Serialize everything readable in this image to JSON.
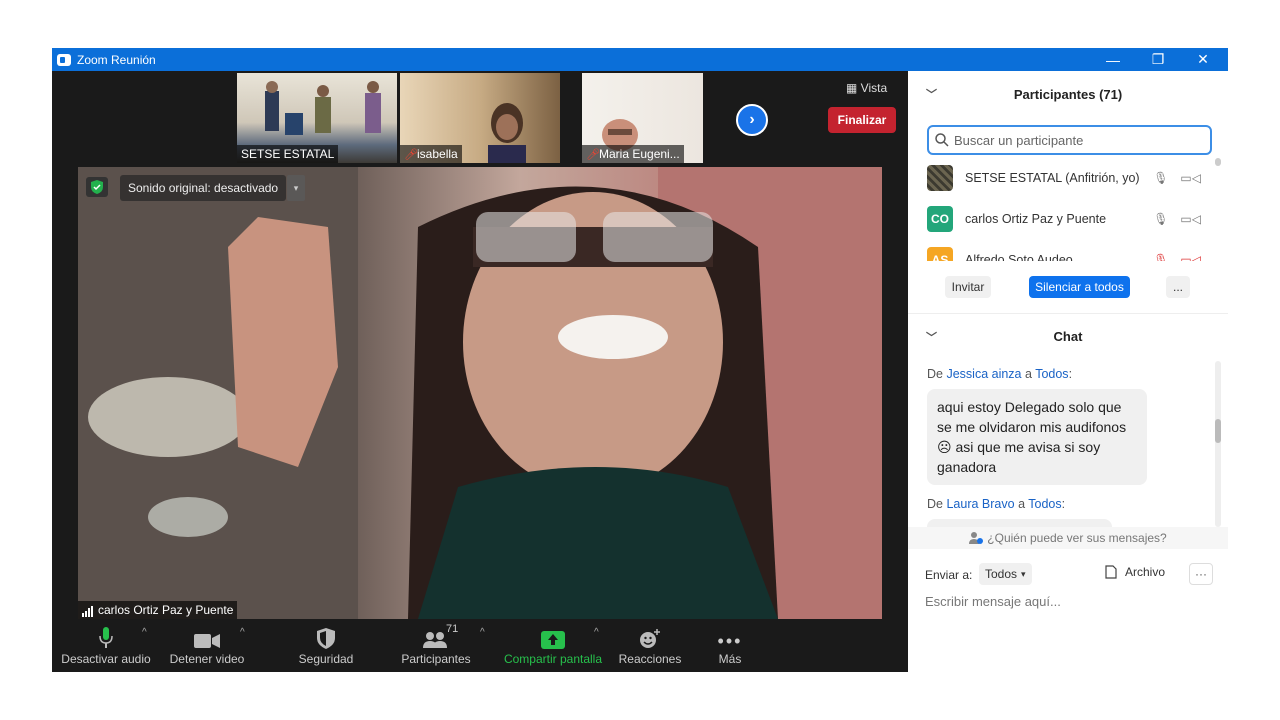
{
  "window": {
    "title": "Zoom Reunión",
    "controls": [
      "—",
      "❐",
      "✕"
    ]
  },
  "thumbnails": [
    {
      "name": "SETSE ESTATAL",
      "muted": false
    },
    {
      "name": "isabella",
      "muted": true
    },
    {
      "name": "Maria Eugeni...",
      "muted": true
    }
  ],
  "vista_label": "Vista",
  "main": {
    "sound_label": "Sonido original: desactivado",
    "speaker": "carlos Ortiz Paz y Puente"
  },
  "toolbar": {
    "audio": "Desactivar audio",
    "video": "Detener video",
    "security": "Seguridad",
    "participants": "Participantes",
    "participants_count": "71",
    "share": "Compartir pantalla",
    "reactions": "Reacciones",
    "more": "Más",
    "end": "Finalizar"
  },
  "participants_panel": {
    "title": "Participantes (71)",
    "search_placeholder": "Buscar un participante",
    "rows": [
      {
        "name": "SETSE ESTATAL (Anfitrión, yo)",
        "initials": "",
        "color": "#5a5a48"
      },
      {
        "name": "carlos Ortiz Paz y Puente",
        "initials": "CO",
        "color": "#23a67a"
      },
      {
        "name": "Alfredo Soto Audeo",
        "initials": "AS",
        "color": "#f5a623"
      }
    ],
    "invite": "Invitar",
    "mute_all": "Silenciar a todos",
    "more": "..."
  },
  "chat": {
    "title": "Chat",
    "messages": [
      {
        "prefix": "De",
        "from": "Jessica ainza",
        "mid": "a",
        "to": "Todos",
        "suffix": ":",
        "text": "aqui estoy Delegado solo que se me olvidaron mis audifonos ☹ asi que me avisa si soy ganadora"
      },
      {
        "prefix": "De",
        "from": "Laura Bravo",
        "mid": "a",
        "to": "Todos",
        "suffix": ":"
      }
    ],
    "who_sees": "¿Quién puede ver sus mensajes?",
    "send_to_label": "Enviar a:",
    "send_to_value": "Todos",
    "file_label": "Archivo",
    "more": "···",
    "input_placeholder": "Escribir mensaje aquí..."
  }
}
